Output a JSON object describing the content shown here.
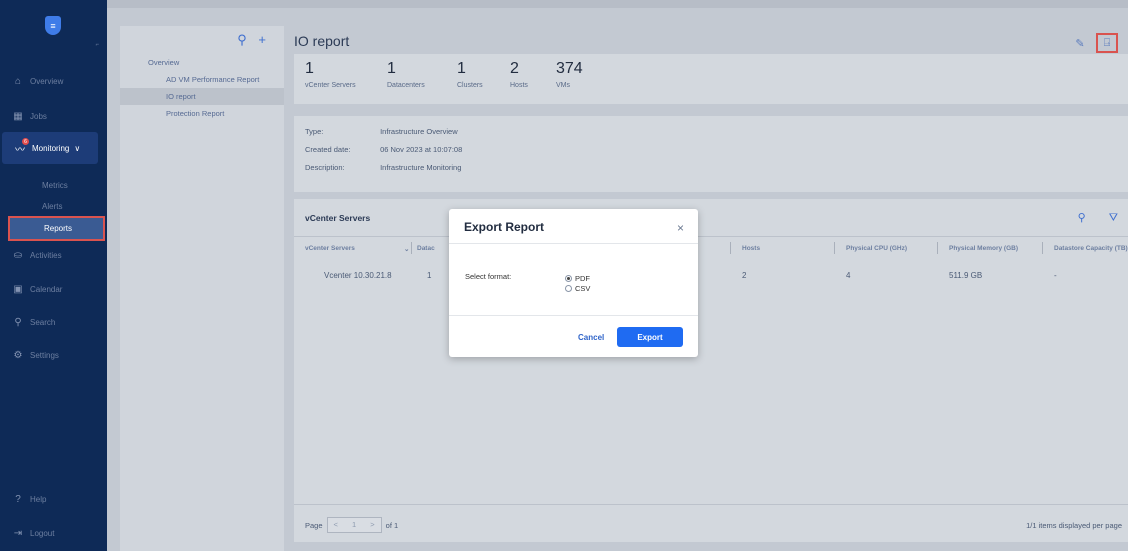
{
  "sidebar": {
    "logo_glyph": "≡",
    "collapse_glyph": "⌐",
    "items": [
      {
        "label": "Overview",
        "icon": "home-icon",
        "glyph": "⌂"
      },
      {
        "label": "Jobs",
        "icon": "grid-icon",
        "glyph": "▦"
      },
      {
        "label": "Monitoring",
        "icon": "chart-line-icon",
        "glyph": "〰",
        "badge": "6",
        "chevron": "∨"
      },
      {
        "label": "Activities",
        "icon": "activities-icon",
        "glyph": "⛀"
      },
      {
        "label": "Calendar",
        "icon": "calendar-icon",
        "glyph": "▣"
      },
      {
        "label": "Search",
        "icon": "search-icon",
        "glyph": "⚲"
      },
      {
        "label": "Settings",
        "icon": "gear-icon",
        "glyph": "⚙"
      },
      {
        "label": "Help",
        "icon": "help-icon",
        "glyph": "?"
      },
      {
        "label": "Logout",
        "icon": "logout-icon",
        "glyph": "⇥"
      }
    ],
    "subitems": [
      "Metrics",
      "Alerts",
      "Reports"
    ]
  },
  "report_list": {
    "actions": "⚲ +",
    "items": [
      {
        "label": "Overview"
      },
      {
        "label": "AD VM Performance Report"
      },
      {
        "label": "IO report"
      },
      {
        "label": "Protection Report"
      }
    ]
  },
  "header": {
    "title": "IO report",
    "edit_icon": "✎",
    "export_icon": "⍈"
  },
  "stats": [
    {
      "value": "1",
      "label": "vCenter Servers"
    },
    {
      "value": "1",
      "label": "Datacenters"
    },
    {
      "value": "1",
      "label": "Clusters"
    },
    {
      "value": "2",
      "label": "Hosts"
    },
    {
      "value": "374",
      "label": "VMs"
    }
  ],
  "info": {
    "type_label": "Type:",
    "type_value": "Infrastructure Overview",
    "created_label": "Created date:",
    "created_value": "06 Nov 2023 at 10:07:08",
    "desc_label": "Description:",
    "desc_value": "Infrastructure Monitoring"
  },
  "table": {
    "title": "vCenter Servers",
    "tools": "⚲ ⛛",
    "columns": [
      "vCenter Servers",
      "Datac",
      "Hosts",
      "Physical CPU (GHz)",
      "Physical Memory (GB)",
      "Datastore Capacity (TB)"
    ],
    "sort_glyph": "⌄",
    "row": [
      "Vcenter 10.30.21.8",
      "1",
      "2",
      "4",
      "511.9 GB",
      "-"
    ],
    "pager": {
      "label": "Page",
      "prev": "<",
      "page": "1",
      "next": ">",
      "of": "of 1"
    },
    "items_info": "1/1 items displayed per page"
  },
  "modal": {
    "title": "Export Report",
    "close": "×",
    "format_label": "Select format:",
    "options": [
      {
        "label": "PDF",
        "selected": true
      },
      {
        "label": "CSV",
        "selected": false
      }
    ],
    "cancel": "Cancel",
    "export": "Export"
  }
}
